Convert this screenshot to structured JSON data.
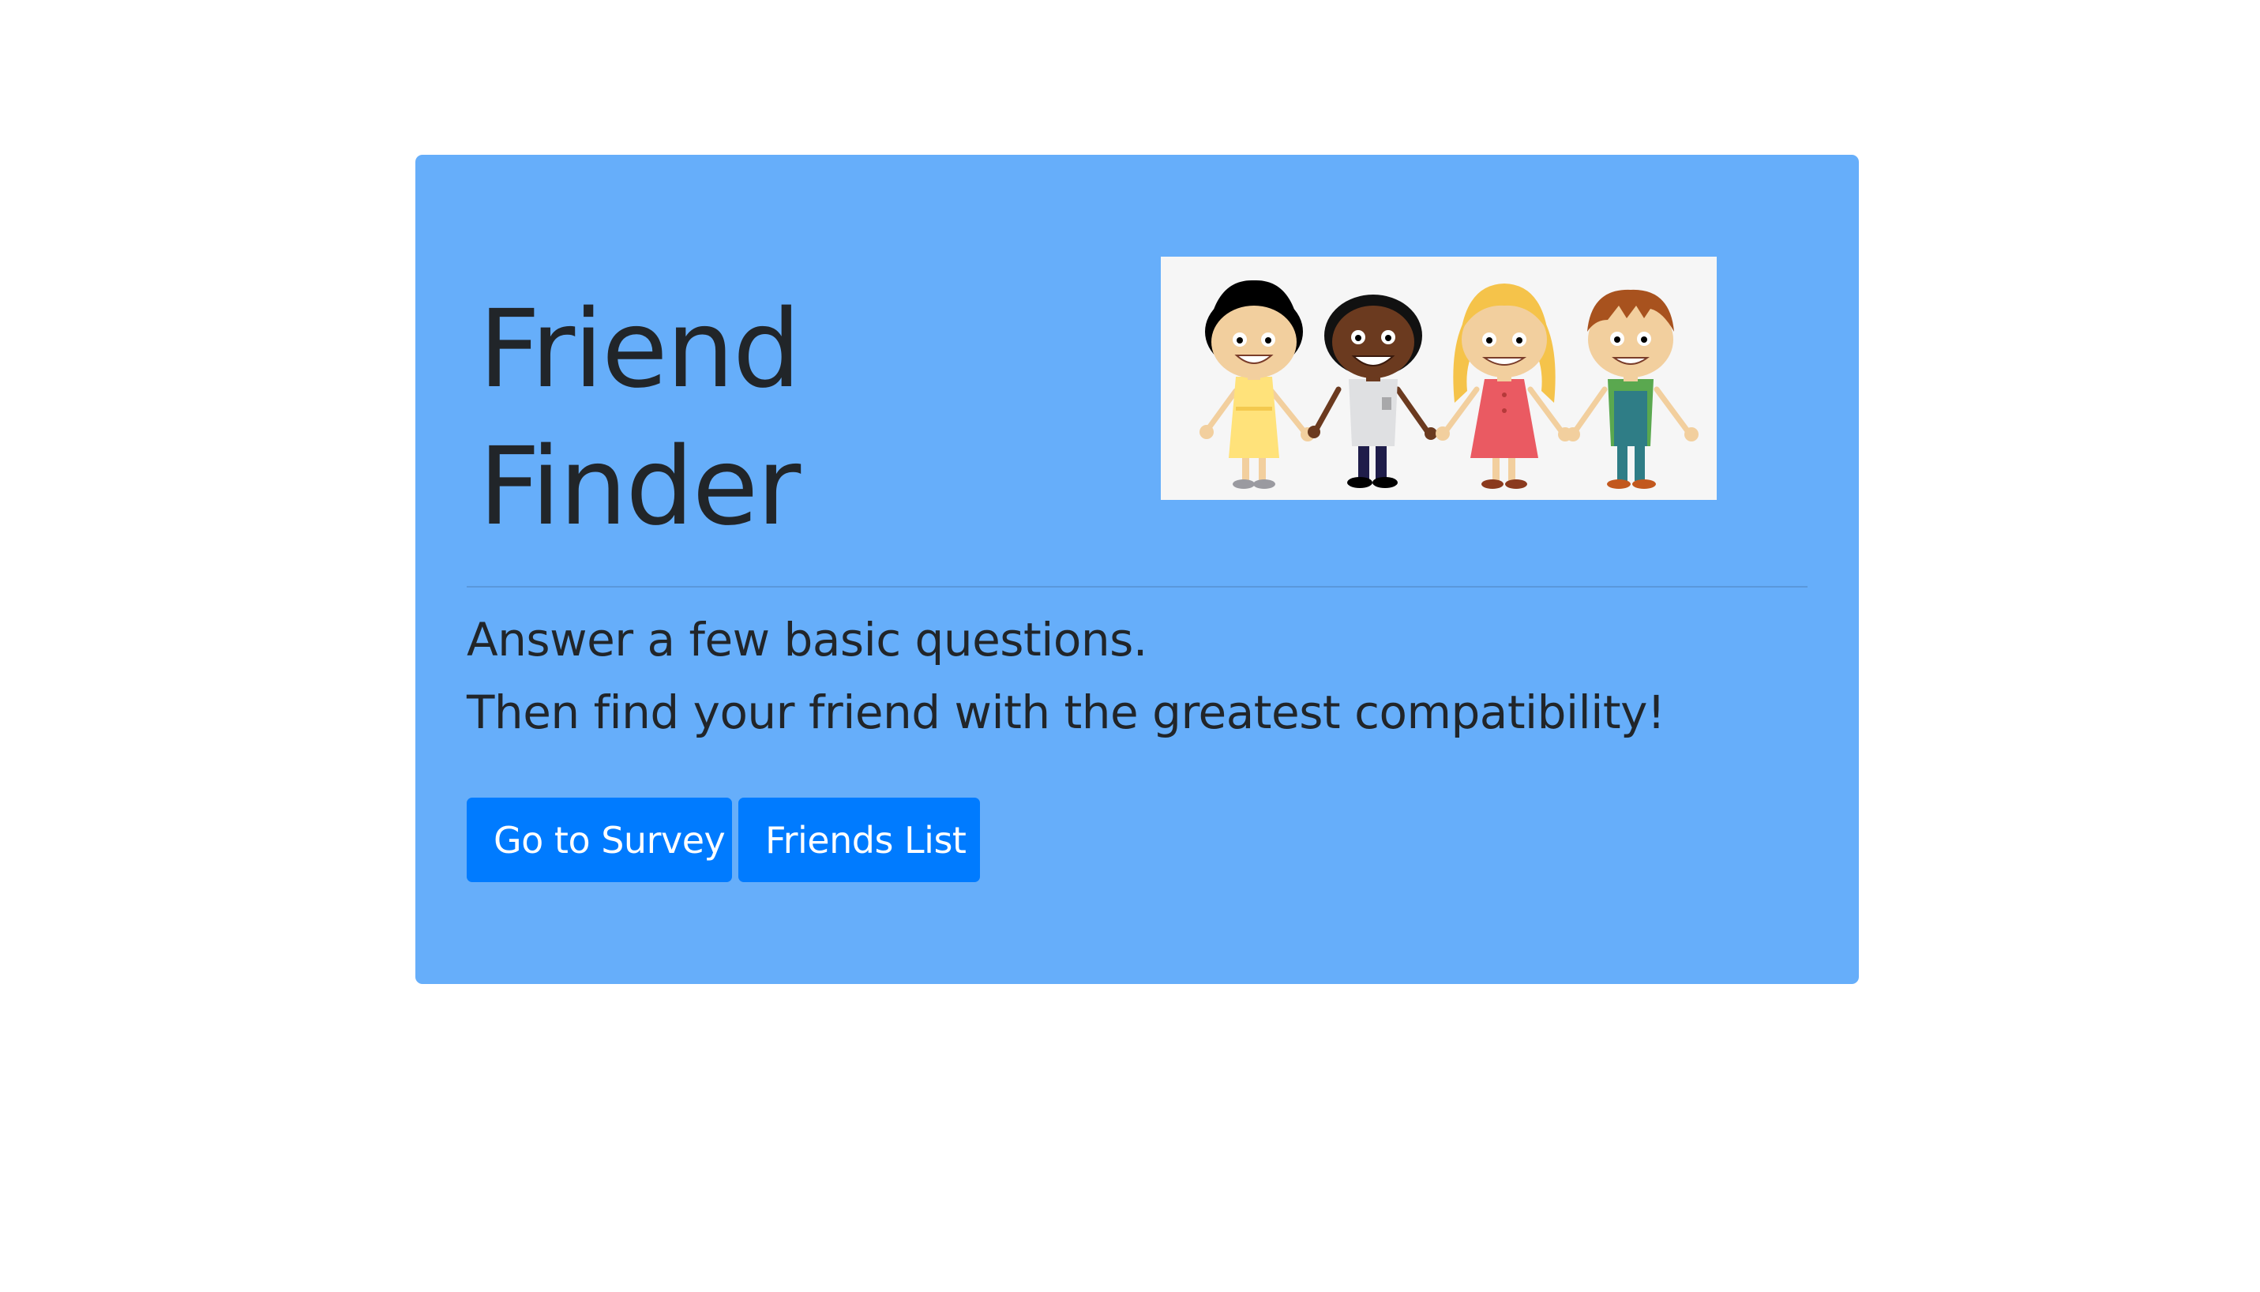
{
  "jumbotron": {
    "title_line_1": "Friend",
    "title_line_2": "Finder",
    "lead_line_1": "Answer a few basic questions.",
    "lead_line_2": "Then find your friend with the greatest compatibility!",
    "background_color": "#66aefa"
  },
  "image": {
    "description_icon": "kids-holding-hands-illustration"
  },
  "buttons": {
    "survey_label": "Go to Survey",
    "friends_label": "Friends List",
    "color": "#007bff"
  }
}
